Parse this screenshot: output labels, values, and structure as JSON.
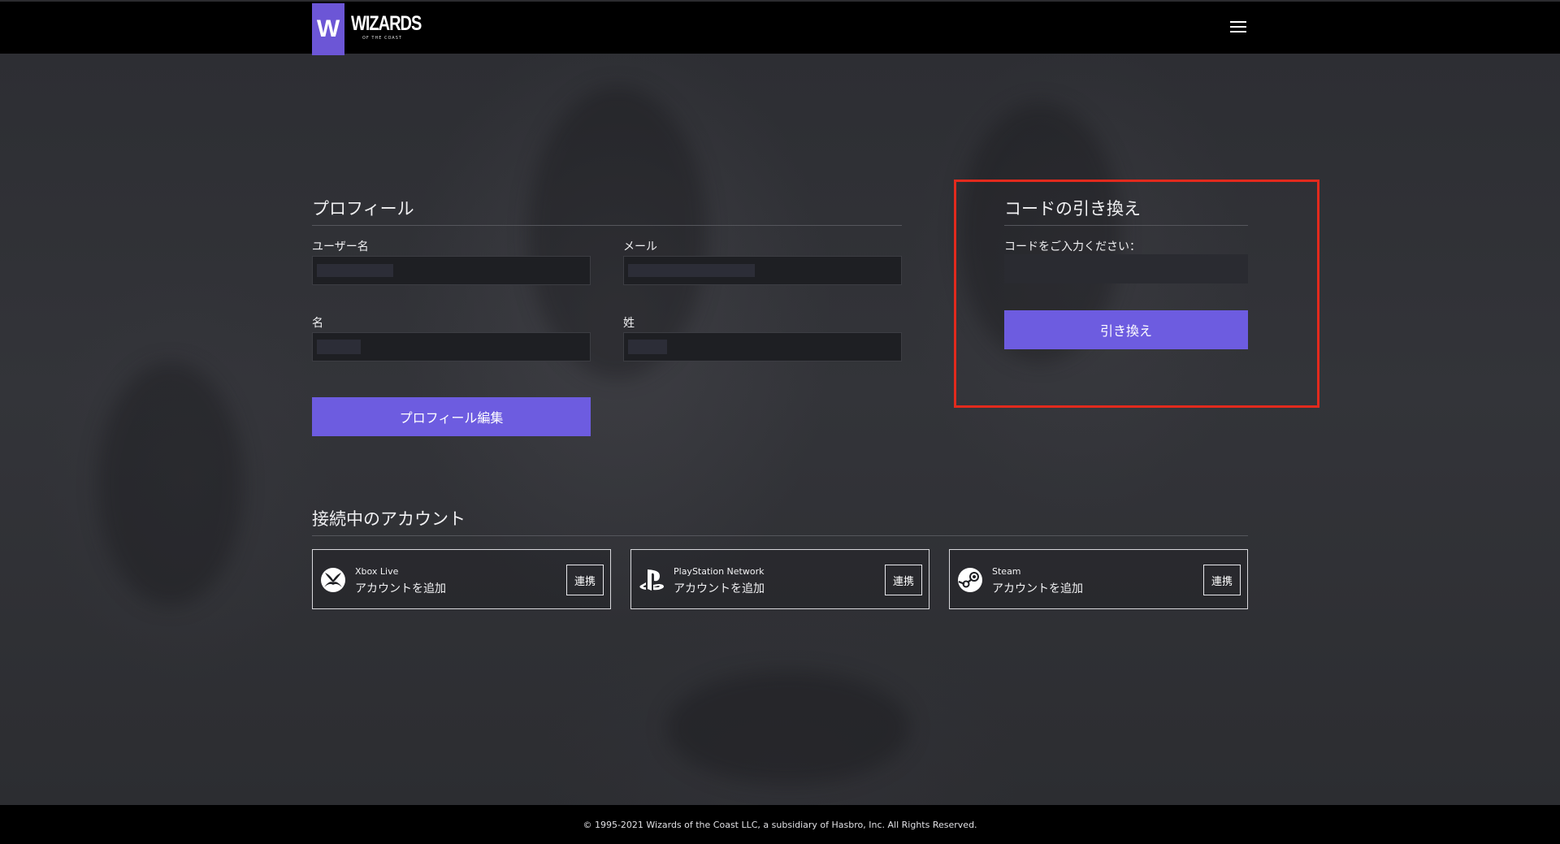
{
  "brand": {
    "logo_letter": "W",
    "logo_word": "WIZARDS",
    "logo_sub": "OF THE COAST",
    "accent": "#6d5ce0"
  },
  "header": {
    "menu_icon": "hamburger-icon"
  },
  "profile": {
    "title": "プロフィール",
    "username_label": "ユーザー名",
    "email_label": "メール",
    "first_name_label": "名",
    "last_name_label": "姓",
    "username_value": "",
    "email_value": "",
    "first_name_value": "",
    "last_name_value": "",
    "edit_button": "プロフィール編集"
  },
  "redeem": {
    "title": "コードの引き換え",
    "code_label": "コードをご入力ください：",
    "code_value": "",
    "button": "引き換え",
    "highlight_color": "#e22a1d"
  },
  "connected": {
    "title": "接続中のアカウント",
    "accounts": [
      {
        "name": "Xbox Live",
        "action": "アカウントを追加",
        "button": "連携",
        "icon": "xbox-icon"
      },
      {
        "name": "PlayStation Network",
        "action": "アカウントを追加",
        "button": "連携",
        "icon": "playstation-icon"
      },
      {
        "name": "Steam",
        "action": "アカウントを追加",
        "button": "連携",
        "icon": "steam-icon"
      }
    ]
  },
  "footer": {
    "copyright": "© 1995-2021 Wizards of the Coast LLC, a subsidiary of Hasbro, Inc. All Rights Reserved."
  }
}
